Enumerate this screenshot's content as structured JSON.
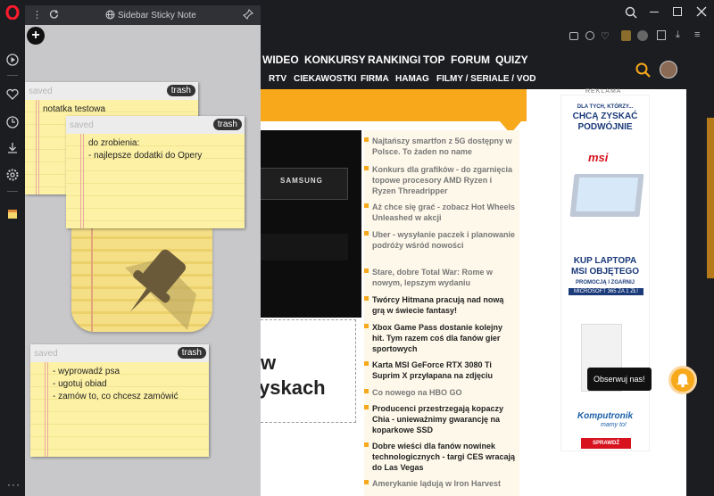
{
  "sidebar_panel": {
    "title": "Sidebar Sticky Note",
    "add_label": "+"
  },
  "notes": [
    {
      "status": "saved",
      "trash": "trash",
      "lines": [
        "notatka testowa"
      ]
    },
    {
      "status": "saved",
      "trash": "trash",
      "lines": [
        "do zrobienia:",
        "- najlepsze dodatki do Opery"
      ]
    },
    {
      "status": "saved",
      "trash": "trash",
      "lines": [
        "- wyprowadź psa",
        "- ugotuj obiad",
        "- zamów to, co chcesz zamówić"
      ]
    }
  ],
  "site": {
    "nav1": [
      "WIDEO",
      "KONKURSY",
      "RANKINGI",
      "TOP",
      "FORUM",
      "QUIZY"
    ],
    "nav2": [
      "RTV",
      "CIEKAWOSTKI",
      "FIRMA",
      "HAMAG",
      "FILMY / SERIALE / VOD"
    ],
    "headline_partial": [
      "w",
      "yskach"
    ],
    "news": [
      "Najtańszy smartfon z 5G dostępny w Polsce. To żaden no name",
      "Konkurs dla grafików - do zgarnięcia topowe procesory AMD Ryzen i Ryzen Threadripper",
      "Aż chce się grać - zobacz Hot Wheels Unleashed w akcji",
      "Uber - wysyłanie paczek i planowanie podróży wśród nowości",
      "Stare, dobre Total War: Rome w nowym, lepszym wydaniu",
      "Twórcy Hitmana pracują nad nową grą w świecie fantasy!",
      "Xbox Game Pass dostanie kolejny hit. Tym razem coś dla fanów gier sportowych",
      "Karta MSI GeForce RTX 3080 Ti Suprim X przyłapana na zdjęciu",
      "Co nowego na HBO GO",
      "Producenci przestrzegają kopaczy Chia - unieważnimy gwarancję na koparkowe SSD",
      "Dobre wieści dla fanów nowinek technologicznych - targi CES wracają do Las Vegas",
      "Amerykanie lądują w Iron Harvest"
    ],
    "ad": {
      "label": "REKLAMA",
      "l1": "DLA TYCH, KTÓRZY...",
      "l2": "CHCĄ ZYSKAĆ",
      "l3": "PODWÓJNIE",
      "brand": "msi",
      "l4": "KUP LAPTOPA",
      "l5": "MSI OBJĘTEGO",
      "l6": "PROMOCJĄ I ZGARNIJ",
      "l7": "MICROSOFT 365 ZA 1 ZŁ!",
      "shop": "Komputronik",
      "shop_sub": "mamy to!",
      "cta": "SPRAWDŹ"
    },
    "follow": "Obserwuj nas!",
    "ssd_label": "SAMSUNG"
  },
  "colors": {
    "accent": "#f7a81b",
    "dark": "#1c1d21",
    "opera": "#ff1b2d"
  }
}
